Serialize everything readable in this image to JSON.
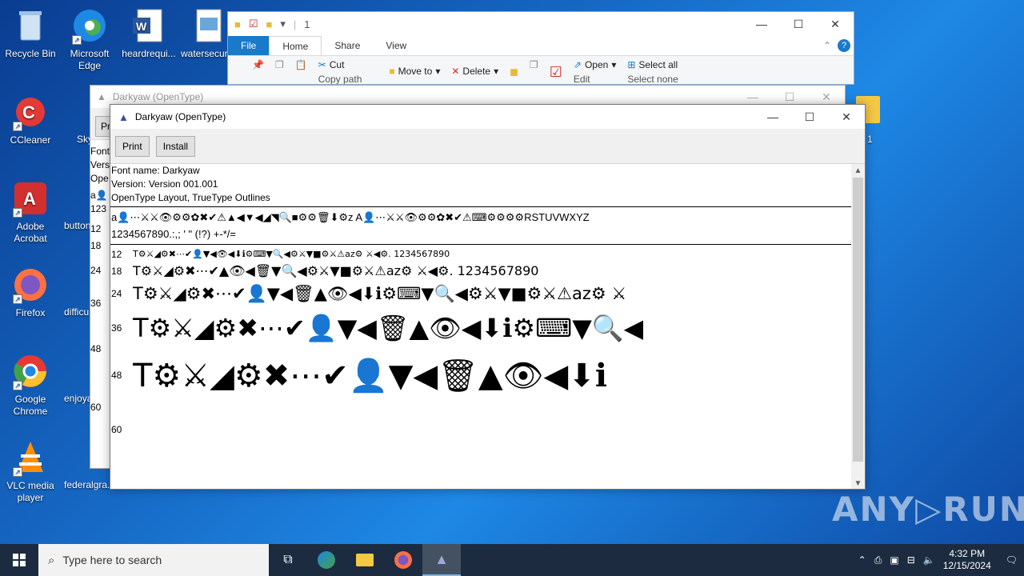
{
  "desktop": {
    "icons": [
      {
        "label": "Recycle Bin",
        "glyph": "🗑"
      },
      {
        "label": "Microsoft Edge",
        "glyph": "e"
      },
      {
        "label": "heardrequi...",
        "glyph": "W"
      },
      {
        "label": "watersecur...",
        "glyph": "▣"
      },
      {
        "label": "CCleaner",
        "glyph": "C"
      },
      {
        "label": "Adobe Acrobat",
        "glyph": "A"
      },
      {
        "label": "Firefox",
        "glyph": "🦊"
      },
      {
        "label": "Google Chrome",
        "glyph": "◉"
      },
      {
        "label": "VLC media player",
        "glyph": "▲"
      }
    ],
    "partial_labels": [
      "Sky",
      "button",
      "difficu",
      "enjoya",
      "federalgra..."
    ],
    "right_partial": "1"
  },
  "explorer": {
    "title": "1",
    "tabs": [
      "File",
      "Home",
      "Share",
      "View"
    ],
    "ribbon": {
      "cut": "Cut",
      "copy_path": "Copy path",
      "move_to": "Move to",
      "delete": "Delete",
      "open": "Open",
      "edit": "Edit",
      "select_all": "Select all",
      "select_none": "Select none"
    }
  },
  "back_window": {
    "title": "Darkyaw (OpenType)",
    "button_stub": "Pr",
    "lines": [
      "Font",
      "Vers",
      "Ope"
    ],
    "sample_sizes": [
      "12",
      "18",
      "24",
      "36",
      "48",
      "60"
    ],
    "partial": "123"
  },
  "font_window": {
    "title": "Darkyaw (OpenType)",
    "buttons": {
      "print": "Print",
      "install": "Install"
    },
    "info": {
      "font_name": "Font name: Darkyaw",
      "version": "Version: Version 001.001",
      "outlines": "OpenType Layout, TrueType Outlines"
    },
    "charset_line1": "a👤⋯⚔⚔👁⚙⚙✿✖✔⚠▲◀▼◀◢◥🔍■⚙⚙🗑⬇⚙z A👤⋯⚔⚔👁⚙⚙✿✖✔⚠⌨⚙⚙⚙⚙RSTUVWXYZ",
    "charset_line2": "1234567890.:,; ' \" (!?) +-*/=",
    "samples": [
      {
        "size": "12",
        "text": "T⚙⚔◢⚙✖⋯✔👤▼◀👁◀⬇ℹ⚙⌨▼🔍◀⚙⚔▼■⚙⚔⚠az⚙ ⚔◀⚙. 1234567890"
      },
      {
        "size": "18",
        "text": "T⚙⚔◢⚙✖⋯✔▲👁◀🗑▼🔍◀⚙⚔▼■⚙⚔⚠az⚙ ⚔◀⚙. 1234567890"
      },
      {
        "size": "24",
        "text": "T⚙⚔◢⚙✖⋯✔👤▼◀🗑▲👁◀⬇ℹ⚙⌨▼🔍◀⚙⚔▼■⚙⚔⚠az⚙ ⚔"
      },
      {
        "size": "36",
        "text": "T⚙⚔◢⚙✖⋯✔👤▼◀🗑▲👁◀⬇ℹ⚙⌨▼🔍◀"
      },
      {
        "size": "48",
        "text": "T⚙⚔◢⚙✖⋯✔👤▼◀🗑▲👁◀⬇ℹ"
      },
      {
        "size": "60",
        "text": ""
      }
    ]
  },
  "taskbar": {
    "search_placeholder": "Type here to search",
    "time": "4:32 PM",
    "date": "12/15/2024"
  },
  "watermark": "ANY▷RUN",
  "colors": {
    "accent": "#1979ca",
    "taskbar": "#1c2b3f"
  }
}
